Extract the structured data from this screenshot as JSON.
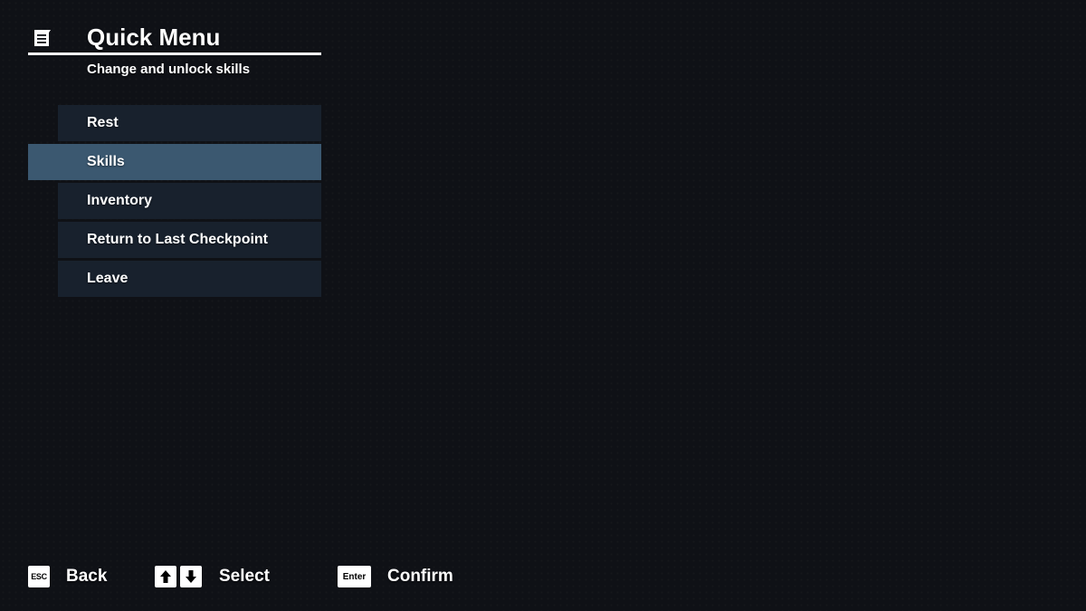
{
  "header": {
    "title": "Quick Menu",
    "subtitle": "Change and unlock skills",
    "icon": "scroll-menu-icon"
  },
  "menu": {
    "selected_index": 1,
    "items": [
      {
        "label": "Rest"
      },
      {
        "label": "Skills"
      },
      {
        "label": "Inventory"
      },
      {
        "label": "Return to Last Checkpoint"
      },
      {
        "label": "Leave"
      }
    ]
  },
  "footer": {
    "back": {
      "key": "ESC",
      "label": "Back"
    },
    "select": {
      "keys": [
        "arrow-up-icon",
        "arrow-down-icon"
      ],
      "label": "Select"
    },
    "confirm": {
      "key": "Enter",
      "label": "Confirm"
    }
  },
  "colors": {
    "background": "#0f1116",
    "menu_item": "#18212d",
    "menu_item_selected": "#3b5870",
    "text": "#ffffff"
  }
}
